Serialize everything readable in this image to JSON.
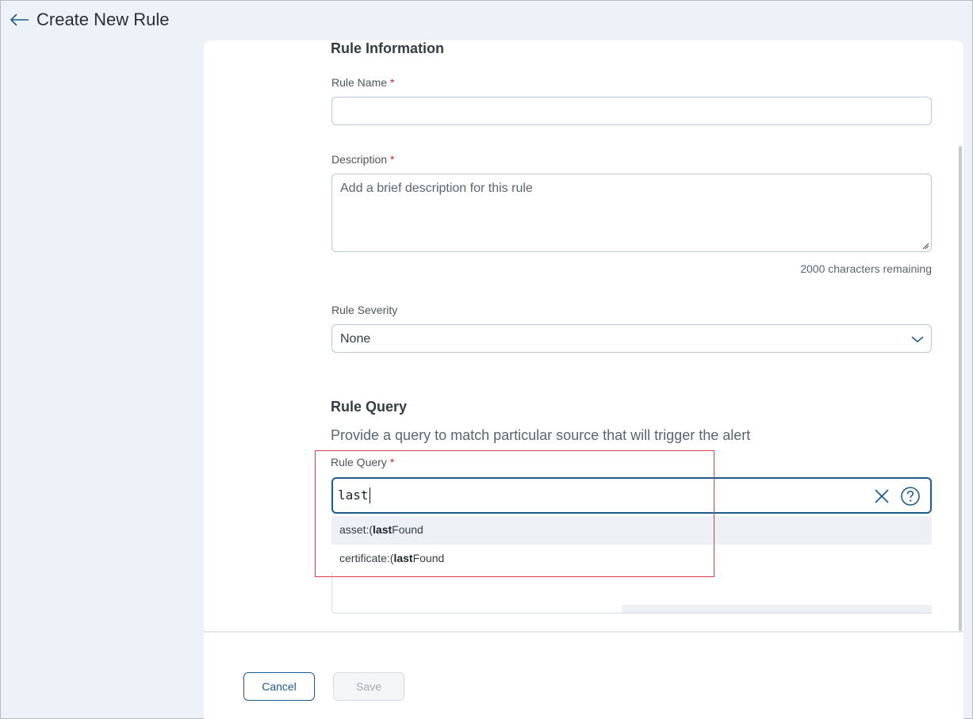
{
  "header": {
    "title": "Create New Rule"
  },
  "rule_information": {
    "heading": "Rule Information",
    "rule_name_label": "Rule Name",
    "rule_name_value": "",
    "required_marker": "*",
    "description_label": "Description",
    "description_placeholder": "Add a brief description for this rule",
    "chars_remaining": "2000 characters remaining",
    "severity_label": "Rule Severity",
    "severity_value": "None"
  },
  "rule_query": {
    "heading": "Rule Query",
    "subtext": "Provide a query to match particular source that will trigger the alert",
    "label": "Rule Query",
    "value": "last",
    "suggestions": [
      {
        "prefix": "asset:(",
        "match": "last",
        "suffix": "Found"
      },
      {
        "prefix": "certificate:(",
        "match": "last",
        "suffix": "Found"
      }
    ]
  },
  "footer": {
    "cancel_label": "Cancel",
    "save_label": "Save"
  },
  "colors": {
    "accent": "#1a5c8e",
    "required": "#d12a2a",
    "highlight": "#e0404a"
  },
  "icons": [
    "back-arrow-icon",
    "chevron-down-icon",
    "clear-icon",
    "help-icon",
    "resize-grip-icon"
  ]
}
